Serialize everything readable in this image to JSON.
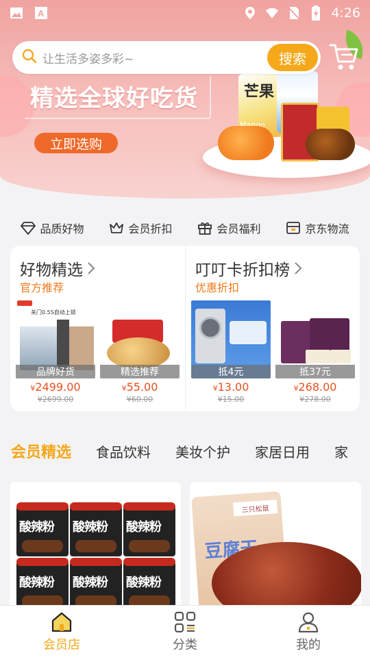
{
  "status_bar": {
    "time": "4:26",
    "icons": [
      "image-icon",
      "text-icon",
      "location-icon",
      "wifi-icon",
      "no-sim-icon",
      "battery-charging-icon"
    ]
  },
  "search": {
    "placeholder": "让生活多姿多彩~",
    "button_label": "搜索"
  },
  "banner": {
    "title": "精选全球好吃货",
    "cta": "立即选购",
    "package_text": [
      "芒果",
      "Mango"
    ]
  },
  "features": [
    {
      "label": "品质好物",
      "icon": "diamond-icon"
    },
    {
      "label": "会员折扣",
      "icon": "crown-icon"
    },
    {
      "label": "会员福利",
      "icon": "gift-icon"
    },
    {
      "label": "京东物流",
      "icon": "box-icon"
    }
  ],
  "promo": {
    "left": {
      "title": "好物精选",
      "subtitle": "官方推荐",
      "items": [
        {
          "tag": "品牌好货",
          "price": "2499.00",
          "original": "2699.00",
          "currency": "¥",
          "image_caption": "关门0.5S自动上锁"
        },
        {
          "tag": "精选推荐",
          "price": "55.00",
          "original": "60.00",
          "currency": "¥",
          "image_caption": ""
        }
      ]
    },
    "right": {
      "title": "叮叮卡折扣榜",
      "subtitle": "优惠折扣",
      "items": [
        {
          "tag": "抵4元",
          "price": "13.00",
          "original": "15.00",
          "currency": "¥"
        },
        {
          "tag": "抵37元",
          "price": "268.00",
          "original": "278.00",
          "currency": "¥"
        }
      ]
    }
  },
  "tabs": [
    "会员精选",
    "食品饮料",
    "美妆个护",
    "家居日用",
    "家"
  ],
  "products": [
    {
      "label": "酸辣粉"
    },
    {
      "label": "豆腐干",
      "brand": "三只松鼠"
    }
  ],
  "bottom_nav": [
    {
      "label": "会员店",
      "active": true
    },
    {
      "label": "分类",
      "active": false
    },
    {
      "label": "我的",
      "active": false
    }
  ],
  "colors": {
    "accent": "#f4a81a",
    "price": "#e8501e",
    "subtitle": "#f07a1e",
    "banner": "#f0a3a0"
  }
}
